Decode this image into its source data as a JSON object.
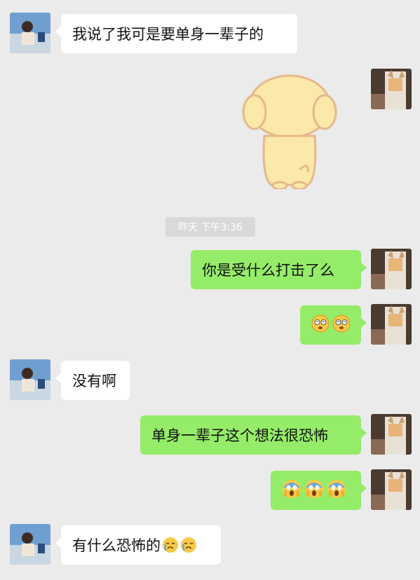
{
  "messages": {
    "m1": {
      "text": "我说了我可是要单身一辈子的"
    },
    "m3": {
      "text": "你是受什么打击了么"
    },
    "m4": {
      "emoji": "dizzy-face-emoji",
      "count": 2
    },
    "m5": {
      "text": "没有啊"
    },
    "m6": {
      "text": "单身一辈子这个想法很恐怖"
    },
    "m7": {
      "emoji": "screaming-face-emoji",
      "count": 3
    },
    "m8": {
      "text": "有什么恐怖的"
    }
  },
  "timestamp": "昨天 下午3:36",
  "colors": {
    "background": "#ebebeb",
    "incoming_bubble": "#ffffff",
    "outgoing_bubble": "#95ec69",
    "timestamp_bg": "#d9d9d9"
  }
}
